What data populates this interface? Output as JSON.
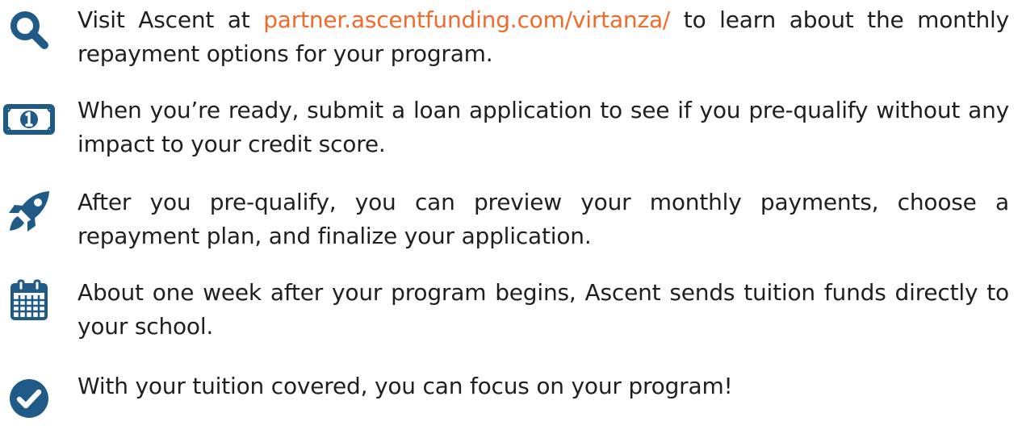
{
  "colors": {
    "text": "#1f1f1f",
    "link": "#f26a2a",
    "icon": "#1f5b86"
  },
  "steps": [
    {
      "icon": "search-icon",
      "text_before": "Visit Ascent at ",
      "link_text": "partner.ascentfunding.com/virtanza/",
      "text_after": " to learn about the monthly repayment options for your program."
    },
    {
      "icon": "money-icon",
      "text": "When you’re ready, submit a loan application to see if you pre-qualify without any impact to your credit score."
    },
    {
      "icon": "rocket-icon",
      "text": "After you pre-qualify, you can preview your monthly payments, choose a repayment plan, and finalize your application."
    },
    {
      "icon": "calendar-icon",
      "text": "About one week after your program begins, Ascent sends tuition funds directly to your school."
    },
    {
      "icon": "check-circle-icon",
      "text": "With your tuition covered, you can focus on your program!"
    }
  ]
}
